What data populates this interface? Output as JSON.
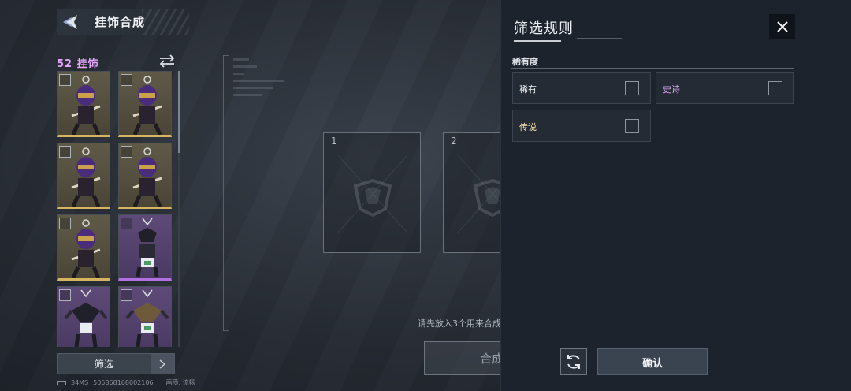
{
  "header": {
    "title": "挂饰合成"
  },
  "inventory": {
    "title": "52 挂饰",
    "items": [
      {
        "rarity": "gold"
      },
      {
        "rarity": "gold"
      },
      {
        "rarity": "gold"
      },
      {
        "rarity": "gold"
      },
      {
        "rarity": "gold"
      },
      {
        "rarity": "purple"
      },
      {
        "rarity": "purple"
      },
      {
        "rarity": "purple"
      }
    ]
  },
  "filter_button": {
    "label": "筛选"
  },
  "status": {
    "ping": "34MS",
    "uid": "505868168002106",
    "quality": "画质: 流畅"
  },
  "slots": [
    {
      "number": "1"
    },
    {
      "number": "2"
    }
  ],
  "hint": "请先放入3个用来合成",
  "compose_button": {
    "label": "合成"
  },
  "panel": {
    "title": "筛选规则",
    "section_label": "稀有度",
    "options": [
      {
        "label": "稀有",
        "color": "#f0f2f5"
      },
      {
        "label": "史诗",
        "color": "#dca7f2"
      },
      {
        "label": "传说",
        "color": "#f2e0a8"
      }
    ],
    "confirm_label": "确认"
  },
  "colors": {
    "gold_border": "#d9b460",
    "purple_border": "#b46fe0",
    "panel_bg": "#1d232d"
  }
}
